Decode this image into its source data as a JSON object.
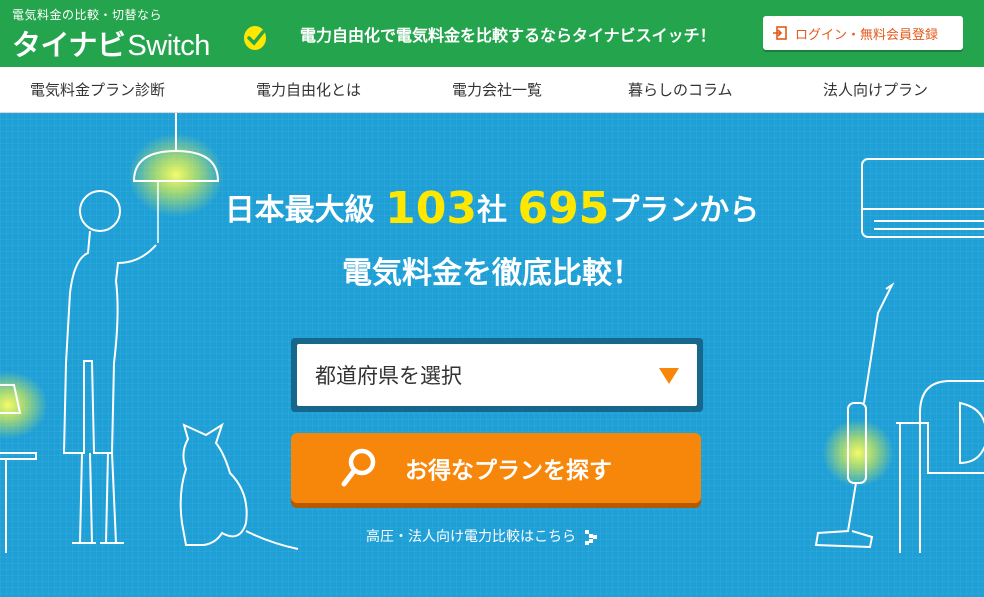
{
  "header": {
    "logo_sub": "電気料金の比較・切替なら",
    "logo_main": "タイナビ",
    "logo_switch": "Switch",
    "tagline": "電力自由化で電気料金を比較するならタイナビスイッチ！",
    "login_label": "ログイン・無料会員登録",
    "logo_mark": "lightbulb-check-icon",
    "login_icon": "login-icon"
  },
  "nav": {
    "items": [
      {
        "label": "電気料金プラン診断"
      },
      {
        "label": "電力自由化とは"
      },
      {
        "label": "電力会社一覧"
      },
      {
        "label": "暮らしのコラム"
      },
      {
        "label": "法人向けプラン"
      }
    ]
  },
  "hero": {
    "headline_pre": "日本最大級",
    "companies": "103",
    "companies_unit": "社",
    "plans": "695",
    "headline_post": "プランから",
    "subheadline": "電気料金を徹底比較！",
    "select_value": "都道府県を選択",
    "search_label": "お得なプランを探す",
    "corp_link": "高圧・法人向け電力比較はこちら",
    "search_icon": "magnifier-icon",
    "arrow_icon": "chevron-right-icon"
  },
  "colors": {
    "brand_green": "#24a54d",
    "hero_blue": "#1e9fd6",
    "accent_yellow": "#ffe800",
    "button_orange": "#f7870a",
    "login_text": "#e2591a"
  }
}
